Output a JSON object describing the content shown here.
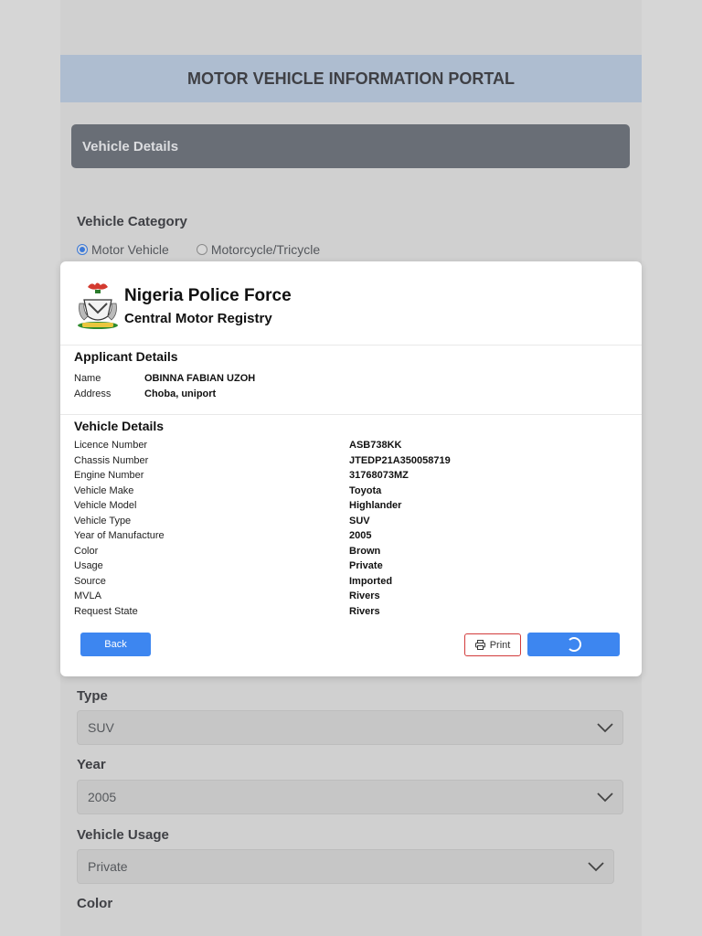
{
  "portal": {
    "title": "MOTOR VEHICLE INFORMATION PORTAL"
  },
  "form": {
    "section_title": "Vehicle Details",
    "category_label": "Vehicle Category",
    "category_options": [
      "Motor Vehicle",
      "Motorcycle/Tricycle"
    ],
    "category_selected": "Motor Vehicle",
    "type_label": "Type",
    "type_value": "SUV",
    "year_label": "Year",
    "year_value": "2005",
    "usage_label": "Vehicle Usage",
    "usage_value": "Private",
    "color_label": "Color"
  },
  "modal": {
    "org_name": "Nigeria Police Force",
    "org_sub": "Central Motor Registry",
    "applicant_title": "Applicant Details",
    "applicant": [
      {
        "key": "Name",
        "value": "OBINNA FABIAN UZOH"
      },
      {
        "key": "Address",
        "value": "Choba, uniport"
      }
    ],
    "vehicle_title": "Vehicle Details",
    "vehicle": [
      {
        "key": "Licence Number",
        "value": "ASB738KK"
      },
      {
        "key": "Chassis Number",
        "value": "JTEDP21A350058719"
      },
      {
        "key": "Engine Number",
        "value": "31768073MZ"
      },
      {
        "key": "Vehicle Make",
        "value": "Toyota"
      },
      {
        "key": "Vehicle Model",
        "value": "Highlander"
      },
      {
        "key": "Vehicle Type",
        "value": "SUV"
      },
      {
        "key": "Year of Manufacture",
        "value": "2005"
      },
      {
        "key": "Color",
        "value": "Brown"
      },
      {
        "key": "Usage",
        "value": "Private"
      },
      {
        "key": "Source",
        "value": "Imported"
      },
      {
        "key": "MVLA",
        "value": "Rivers"
      },
      {
        "key": "Request State",
        "value": "Rivers"
      }
    ],
    "back_label": "Back",
    "print_label": "Print",
    "submit_state_icon": "loading-spinner-icon"
  },
  "colors": {
    "accent": "#3d86f0",
    "header_bg": "#aebdd0",
    "section_bg": "#696e76",
    "print_border": "#d23b3b"
  }
}
